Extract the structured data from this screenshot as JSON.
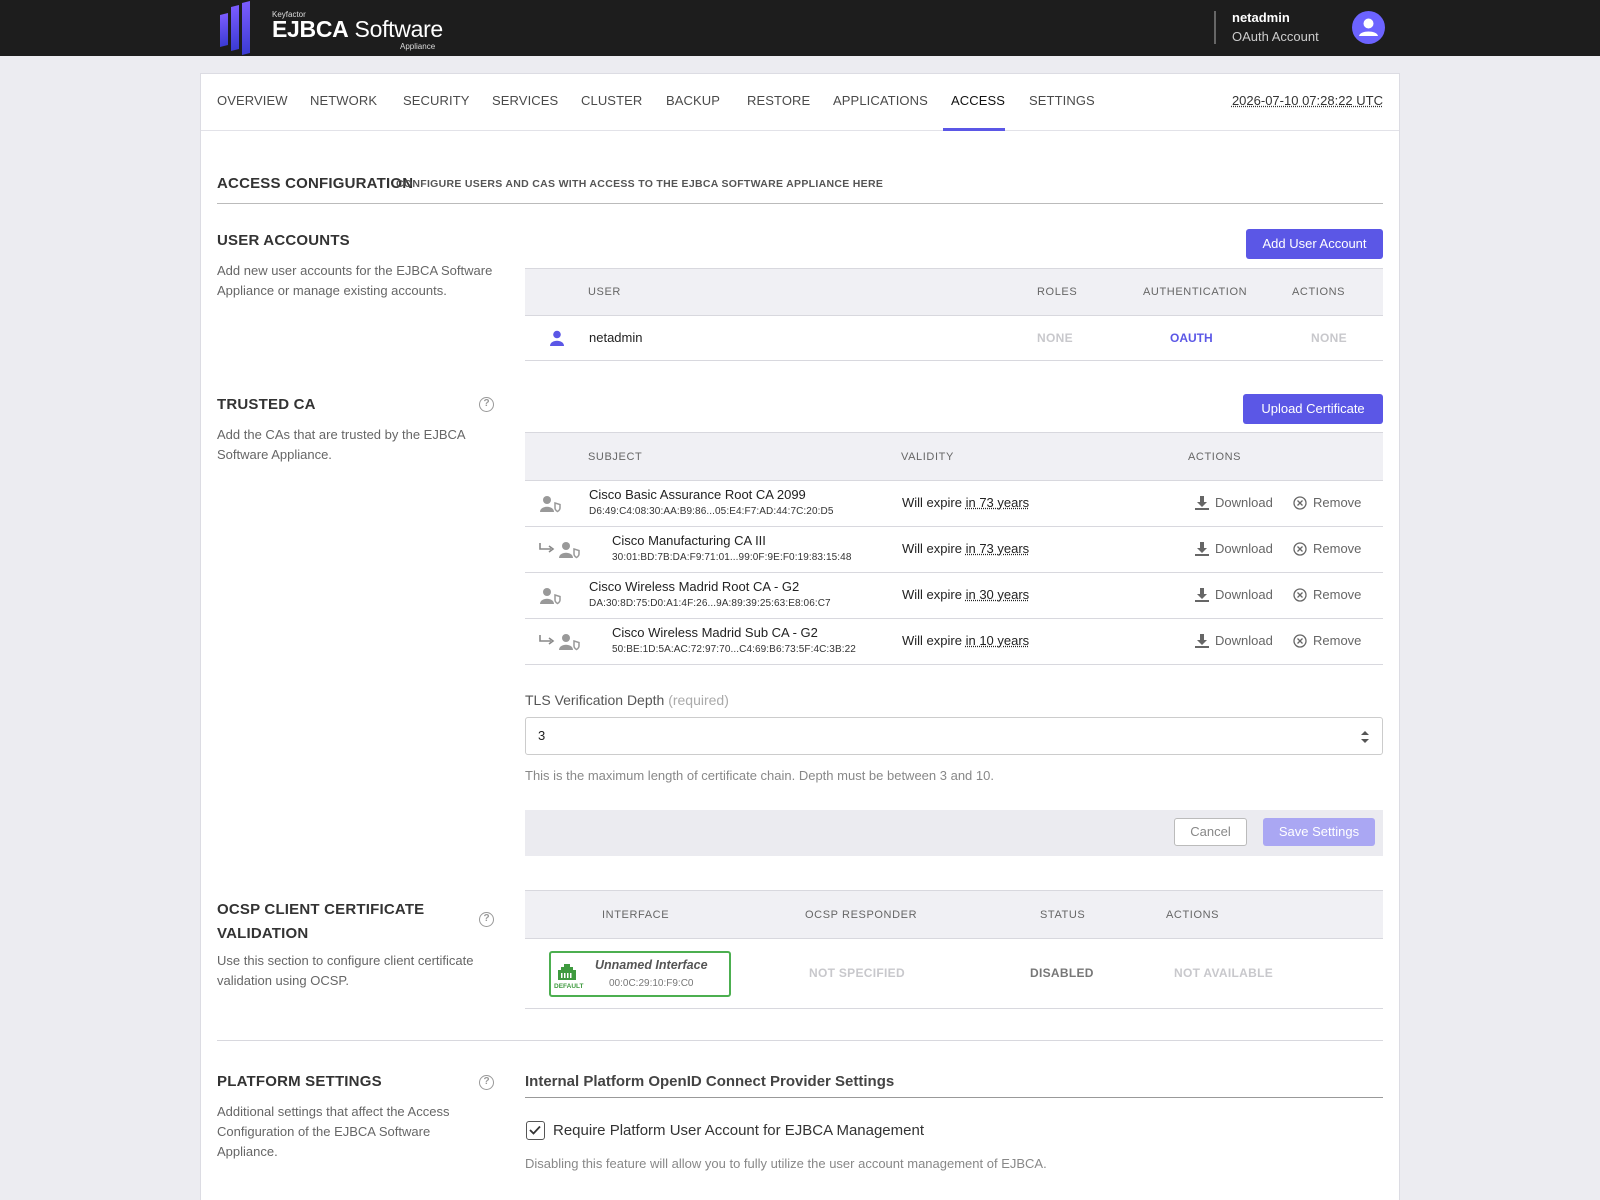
{
  "header": {
    "logo_small": "Keyfactor",
    "logo_bold": "EJBCA",
    "logo_rest": " Software",
    "logo_sub": "Appliance",
    "user_name": "netadmin",
    "user_account": "OAuth Account"
  },
  "nav": {
    "tabs": [
      "OVERVIEW",
      "NETWORK",
      "SECURITY",
      "SERVICES",
      "CLUSTER",
      "BACKUP",
      "RESTORE",
      "APPLICATIONS",
      "ACCESS",
      "SETTINGS"
    ],
    "active": "ACCESS",
    "clock": "2026-07-10 07:28:22 UTC"
  },
  "page": {
    "title": "ACCESS CONFIGURATION",
    "subtitle": "CONFIGURE USERS AND CAS WITH ACCESS TO THE EJBCA SOFTWARE APPLIANCE HERE"
  },
  "user_accounts": {
    "title": "USER ACCOUNTS",
    "description": "Add new user accounts for the EJBCA Software Appliance or manage existing accounts.",
    "add_button": "Add User Account",
    "columns": [
      "USER",
      "ROLES",
      "AUTHENTICATION",
      "ACTIONS"
    ],
    "rows": [
      {
        "user": "netadmin",
        "roles": "NONE",
        "authentication": "OAUTH",
        "actions": "NONE"
      }
    ]
  },
  "trusted_ca": {
    "title": "TRUSTED CA",
    "description": "Add the CAs that are trusted by the EJBCA Software Appliance.",
    "upload_button": "Upload Certificate",
    "columns": [
      "SUBJECT",
      "VALIDITY",
      "ACTIONS"
    ],
    "validity_prefix": "Will expire",
    "download_label": "Download",
    "remove_label": "Remove",
    "rows": [
      {
        "subject": "Cisco Basic Assurance Root CA 2099",
        "fingerprint": "D6:49:C4:08:30:AA:B9:86...05:E4:F7:AD:44:7C:20:D5",
        "expiry": "in 73 years",
        "child": false
      },
      {
        "subject": "Cisco Manufacturing CA III",
        "fingerprint": "30:01:BD:7B:DA:F9:71:01...99:0F:9E:F0:19:83:15:48",
        "expiry": "in 73 years",
        "child": true
      },
      {
        "subject": "Cisco Wireless Madrid Root CA - G2",
        "fingerprint": "DA:30:8D:75:D0:A1:4F:26...9A:89:39:25:63:E8:06:C7",
        "expiry": "in 30 years",
        "child": false
      },
      {
        "subject": "Cisco Wireless Madrid Sub CA - G2",
        "fingerprint": "50:BE:1D:5A:AC:72:97:70...C4:69:B6:73:5F:4C:3B:22",
        "expiry": "in 10 years",
        "child": true
      }
    ],
    "tls_label": "TLS Verification Depth",
    "tls_required": "(required)",
    "tls_value": "3",
    "tls_help": "This is the maximum length of certificate chain. Depth must be between 3 and 10.",
    "cancel_button": "Cancel",
    "save_button": "Save Settings"
  },
  "ocsp": {
    "title_line1": "OCSP CLIENT CERTIFICATE",
    "title_line2": "VALIDATION",
    "description": "Use this section to configure client certificate validation using OCSP.",
    "columns": [
      "INTERFACE",
      "OCSP RESPONDER",
      "STATUS",
      "ACTIONS"
    ],
    "interface_name": "Unnamed Interface",
    "interface_mac": "00:0C:29:10:F9:C0",
    "interface_badge": "DEFAULT",
    "responder": "NOT SPECIFIED",
    "status": "DISABLED",
    "actions": "NOT AVAILABLE"
  },
  "platform": {
    "title": "PLATFORM SETTINGS",
    "description": "Additional settings that affect the Access Configuration of the EJBCA Software Appliance.",
    "subheading": "Internal Platform OpenID Connect Provider Settings",
    "checkbox_label": "Require Platform User Account for EJBCA Management",
    "checkbox_checked": true,
    "checkbox_help": "Disabling this feature will allow you to fully utilize the user account management of EJBCA."
  },
  "colors": {
    "accent": "#5b57e6",
    "topbar": "#1d1d1d",
    "interface_border": "#4caf50"
  }
}
